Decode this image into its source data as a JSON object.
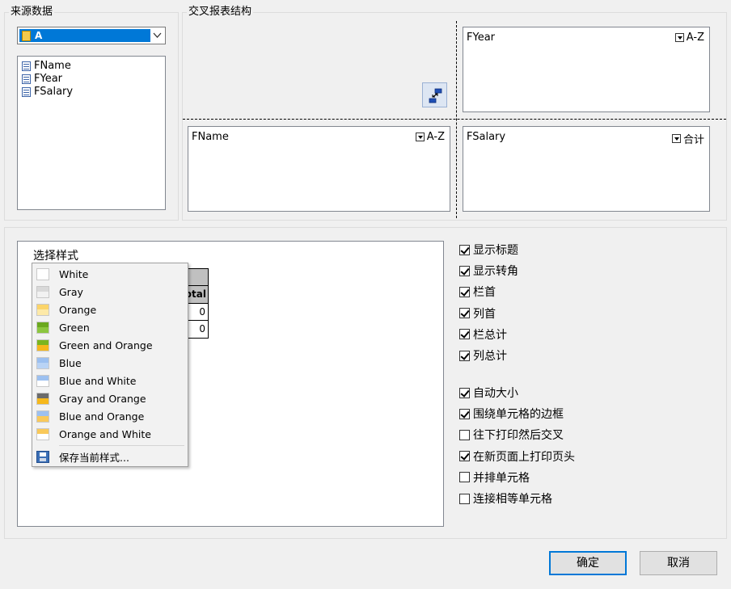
{
  "source": {
    "group_title": "来源数据",
    "combo_value": "A",
    "fields": [
      "FName",
      "FYear",
      "FSalary"
    ]
  },
  "structure": {
    "group_title": "交叉报表结构",
    "column_zone": {
      "field": "FYear",
      "sort": "A-Z"
    },
    "row_zone": {
      "field": "FName",
      "sort": "A-Z"
    },
    "data_zone": {
      "field": "FSalary",
      "aggregate": "合计"
    },
    "swap_icon": "swap-axes-icon"
  },
  "style": {
    "label": "选择样式",
    "menu": [
      {
        "label": "White",
        "colors": [
          "#ffffff",
          "#ffffff"
        ]
      },
      {
        "label": "Gray",
        "colors": [
          "#d9d9d9",
          "#f2f2f2"
        ]
      },
      {
        "label": "Orange",
        "colors": [
          "#fbd46a",
          "#fde9a8"
        ]
      },
      {
        "label": "Green",
        "colors": [
          "#6aa81e",
          "#8cc63f"
        ]
      },
      {
        "label": "Green and Orange",
        "colors": [
          "#7bb51f",
          "#f6b81c"
        ]
      },
      {
        "label": "Blue",
        "colors": [
          "#9cc0f0",
          "#b9d3f5"
        ]
      },
      {
        "label": "Blue and White",
        "colors": [
          "#9cc0f0",
          "#ffffff"
        ]
      },
      {
        "label": "Gray and Orange",
        "colors": [
          "#6b6b6b",
          "#f6b81c"
        ]
      },
      {
        "label": "Blue and Orange",
        "colors": [
          "#9cc0f0",
          "#f9c95a"
        ]
      },
      {
        "label": "Orange and White",
        "colors": [
          "#f9c95a",
          "#ffffff"
        ]
      }
    ],
    "save_label": "保存当前样式...",
    "preview": {
      "header_partial": "otal",
      "values": [
        "0",
        "0"
      ]
    }
  },
  "options_group1": [
    {
      "label": "显示标题",
      "checked": true
    },
    {
      "label": "显示转角",
      "checked": true
    },
    {
      "label": "栏首",
      "checked": true
    },
    {
      "label": "列首",
      "checked": true
    },
    {
      "label": "栏总计",
      "checked": true
    },
    {
      "label": "列总计",
      "checked": true
    }
  ],
  "options_group2": [
    {
      "label": "自动大小",
      "checked": true
    },
    {
      "label": "围绕单元格的边框",
      "checked": true
    },
    {
      "label": "往下打印然后交叉",
      "checked": false
    },
    {
      "label": "在新页面上打印页头",
      "checked": true
    },
    {
      "label": "并排单元格",
      "checked": false
    },
    {
      "label": "连接相等单元格",
      "checked": false
    }
  ],
  "buttons": {
    "ok": "确定",
    "cancel": "取消"
  }
}
